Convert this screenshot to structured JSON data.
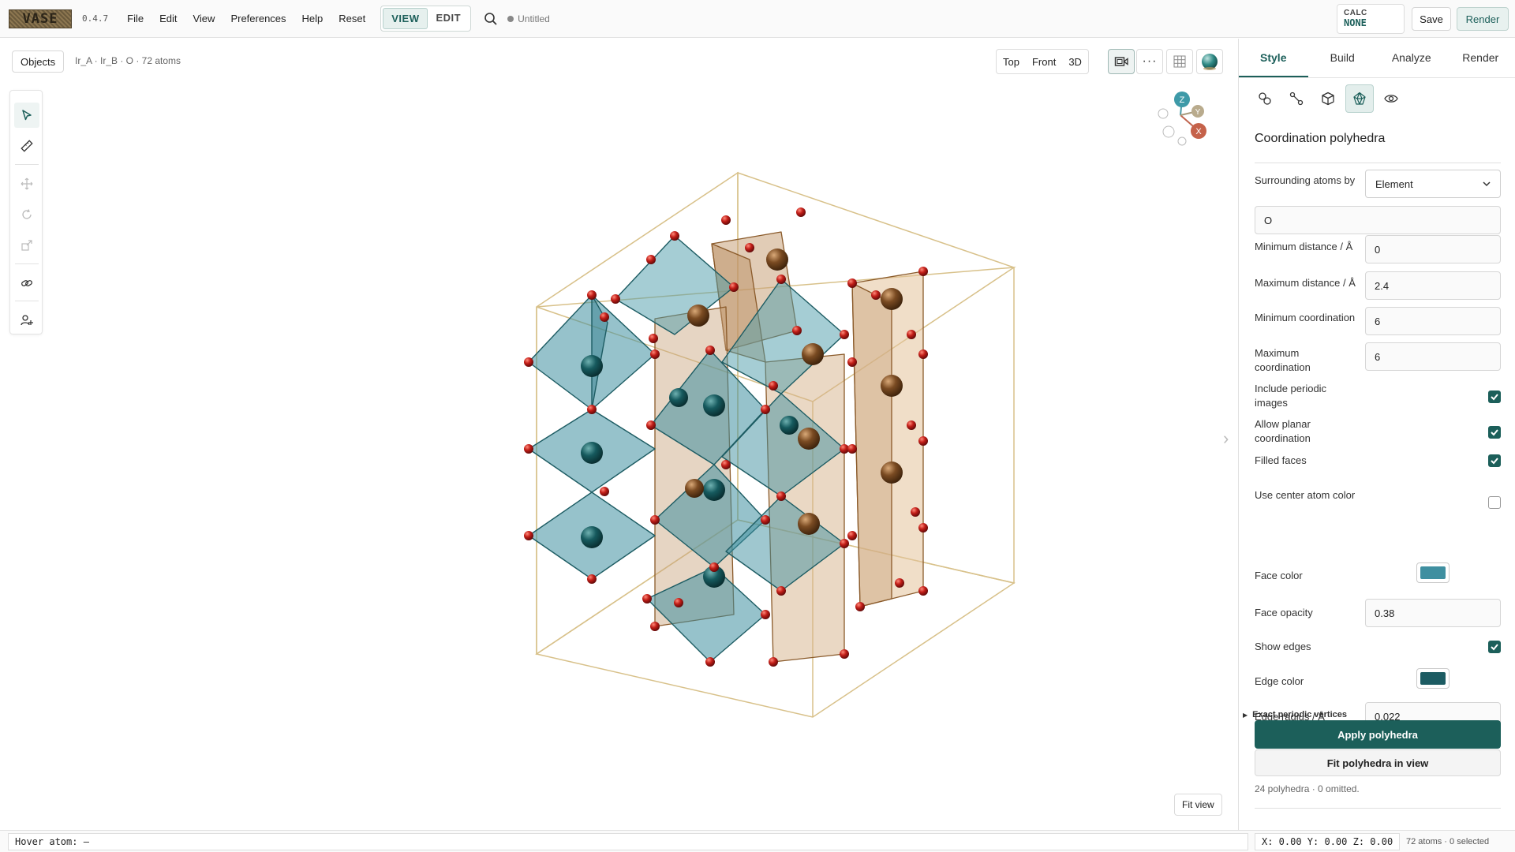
{
  "app": {
    "logo_text": "VASE",
    "version": "0.4.7",
    "document_title": "Untitled"
  },
  "menu": [
    "File",
    "Edit",
    "View",
    "Preferences",
    "Help",
    "Reset"
  ],
  "mode": {
    "view_label": "VIEW",
    "edit_label": "EDIT",
    "active": "VIEW"
  },
  "calc": {
    "label": "CALC",
    "value": "NONE"
  },
  "actions": {
    "save_label": "Save",
    "render_label": "Render"
  },
  "viewport": {
    "objects_label": "Objects",
    "structure_label": "Ir_A · Ir_B · O · 72 atoms",
    "view_buttons": [
      "Top",
      "Front",
      "3D"
    ],
    "fit_view_label": "Fit view",
    "axes": {
      "z": "Z",
      "y": "Y",
      "x": "X"
    }
  },
  "tools": [
    "select-tool",
    "measure-tool",
    "move-tool",
    "rotate-tool",
    "scale-tool",
    "bond-tool",
    "add-atom-tool"
  ],
  "panel": {
    "tabs": [
      "Style",
      "Build",
      "Analyze",
      "Render"
    ],
    "active_tab": "Style",
    "section_title": "Coordination polyhedra",
    "surrounding_label": "Surrounding atoms by",
    "surrounding_value": "Element",
    "element_value": "O",
    "min_distance_label": "Minimum distance / Å",
    "min_distance_value": "0",
    "max_distance_label": "Maximum distance / Å",
    "max_distance_value": "2.4",
    "min_coord_label": "Minimum coordination",
    "min_coord_value": "6",
    "max_coord_label": "Maximum coordination",
    "max_coord_value": "6",
    "include_periodic_label": "Include periodic images",
    "include_periodic": true,
    "allow_planar_label": "Allow planar coordination",
    "allow_planar": true,
    "filled_faces_label": "Filled faces",
    "filled_faces": true,
    "use_center_label": "Use center atom color",
    "use_center": false,
    "face_color_label": "Face color",
    "face_color": "#3f8fa0",
    "face_opacity_label": "Face opacity",
    "face_opacity_value": "0.38",
    "show_edges_label": "Show edges",
    "show_edges": true,
    "edge_color_label": "Edge color",
    "edge_color": "#1d5c63",
    "edge_radius_label": "Edge radius / Å",
    "edge_radius_value": "0.022",
    "exact_periodic_label": "Exact periodic vertices",
    "apply_label": "Apply polyhedra",
    "fit_label": "Fit polyhedra in view",
    "status": "24 polyhedra · 0 omitted."
  },
  "statusbar": {
    "hover": "Hover atom: —",
    "coords": "X: 0.00 Y: 0.00 Z: 0.00",
    "selection": "72 atoms · 0 selected"
  },
  "colors": {
    "accent": "#1c5f5a",
    "teal_poly": "#3f8fa0",
    "brown_poly": "#c8a27a",
    "oxygen": "#b3201d"
  }
}
